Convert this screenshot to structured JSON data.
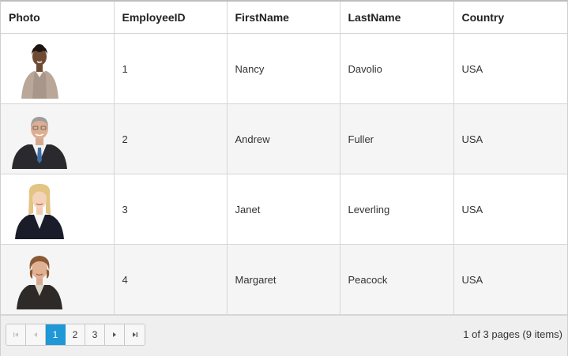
{
  "columns": [
    "Photo",
    "EmployeeID",
    "FirstName",
    "LastName",
    "Country"
  ],
  "rows": [
    {
      "id": "1",
      "first": "Nancy",
      "last": "Davolio",
      "country": "USA",
      "photo": "employee-photo-woman-beige-jacket"
    },
    {
      "id": "2",
      "first": "Andrew",
      "last": "Fuller",
      "country": "USA",
      "photo": "employee-photo-man-suit"
    },
    {
      "id": "3",
      "first": "Janet",
      "last": "Leverling",
      "country": "USA",
      "photo": "employee-photo-woman-blonde"
    },
    {
      "id": "4",
      "first": "Margaret",
      "last": "Peacock",
      "country": "USA",
      "photo": "employee-photo-woman-dark-suit"
    }
  ],
  "pager": {
    "pages": [
      "1",
      "2",
      "3"
    ],
    "current": "1",
    "info": "1 of 3 pages (9 items)",
    "icons": [
      "first-page-icon",
      "prev-page-icon",
      "next-page-icon",
      "last-page-icon"
    ]
  },
  "colors": {
    "accent": "#1e98d7",
    "alt_row": "#f5f5f5",
    "border": "#d6d6d6"
  }
}
